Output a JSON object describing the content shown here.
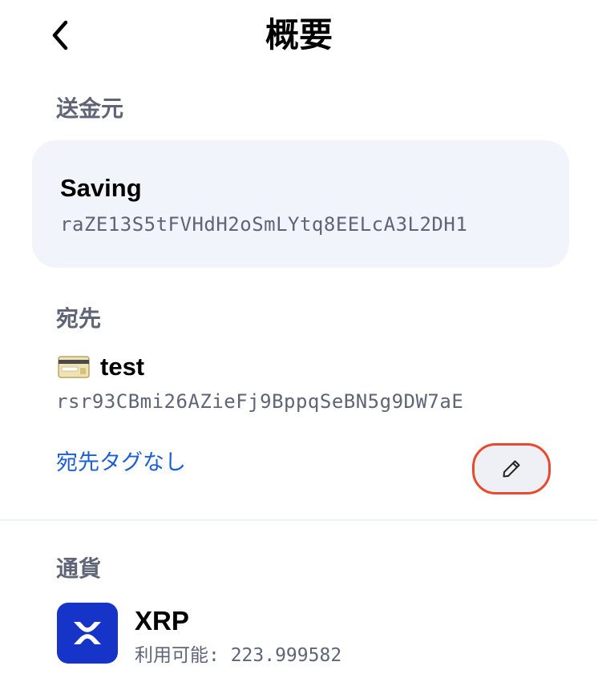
{
  "header": {
    "title": "概要",
    "back_icon": "chevron-left-icon"
  },
  "from": {
    "label": "送金元",
    "account_name": "Saving",
    "address": "raZE13S5tFVHdH2oSmLYtq8EELcA3L2DH1"
  },
  "to": {
    "label": "宛先",
    "icon": "credit-card-icon",
    "name": "test",
    "address": "rsr93CBmi26AZieFj9BppqSeBN5g9DW7aE",
    "destination_tag_text": "宛先タグなし",
    "edit_icon": "pencil-icon"
  },
  "currency": {
    "label": "通貨",
    "icon": "xrp-logo-icon",
    "name": "XRP",
    "available": "利用可能: 223.999582"
  },
  "colors": {
    "accent_blue": "#1d5fd6",
    "xrp_blue": "#1634c8",
    "card_bg": "#f1f4fa",
    "highlight_red": "#e8492f",
    "muted_text": "#5f6477"
  }
}
